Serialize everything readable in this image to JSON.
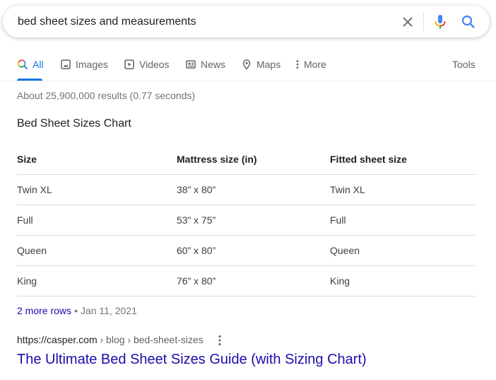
{
  "search": {
    "query": "bed sheet sizes and measurements",
    "clear_icon": "close-icon",
    "mic_icon": "microphone-icon",
    "search_icon": "search-icon"
  },
  "nav": {
    "tabs": [
      {
        "label": "All",
        "icon": "search-icon",
        "active": true
      },
      {
        "label": "Images",
        "icon": "image-icon"
      },
      {
        "label": "Videos",
        "icon": "video-play-icon"
      },
      {
        "label": "News",
        "icon": "newspaper-icon"
      },
      {
        "label": "Maps",
        "icon": "map-pin-icon"
      },
      {
        "label": "More",
        "icon": "vertical-dots-icon"
      }
    ],
    "tools_label": "Tools"
  },
  "results_stats": "About 25,900,000 results (0.77 seconds)",
  "featured_snippet": {
    "title": "Bed Sheet Sizes Chart",
    "table": {
      "headers": [
        "Size",
        "Mattress size (in)",
        "Fitted sheet size"
      ],
      "rows": [
        [
          "Twin XL",
          "38” x 80”",
          "Twin XL"
        ],
        [
          "Full",
          "53” x 75”",
          "Full"
        ],
        [
          "Queen",
          "60” x 80”",
          "Queen"
        ],
        [
          "King",
          "76” x 80”",
          "King"
        ]
      ]
    },
    "more_rows_label": "2 more rows",
    "separator": "•",
    "date": "Jan 11, 2021"
  },
  "result": {
    "url_base": "https://casper.com",
    "url_crumbs": " › blog › bed-sheet-sizes",
    "title": "The Ultimate Bed Sheet Sizes Guide (with Sizing Chart)"
  },
  "colors": {
    "accent": "#1a73e8",
    "link": "#1a0dab",
    "muted": "#70757a"
  }
}
